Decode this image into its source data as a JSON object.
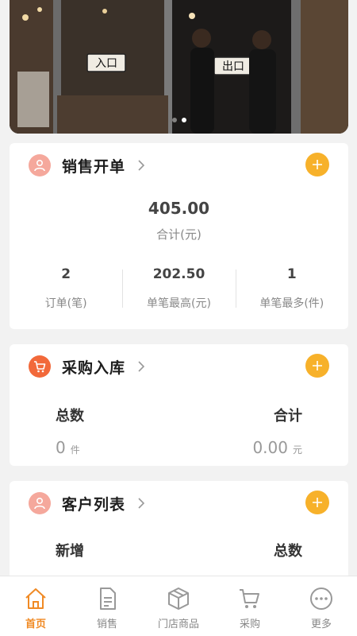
{
  "banner": {
    "sign_left": "入口",
    "sign_right": "出口",
    "slides": 2,
    "active_slide": 1
  },
  "sales": {
    "title": "销售开单",
    "total_value": "405.00",
    "total_label": "合计(元)",
    "stats": [
      {
        "value": "2",
        "label": "订单(笔)"
      },
      {
        "value": "202.50",
        "label": "单笔最高(元)"
      },
      {
        "value": "1",
        "label": "单笔最多(件)"
      }
    ]
  },
  "purchase": {
    "title": "采购入库",
    "left_head": "总数",
    "left_value": "0",
    "left_unit": "件",
    "right_head": "合计",
    "right_value": "0.00",
    "right_unit": "元"
  },
  "customers": {
    "title": "客户列表",
    "left_head": "新增",
    "right_head": "总数"
  },
  "tabbar": {
    "items": [
      {
        "label": "首页",
        "icon": "home-icon",
        "active": true
      },
      {
        "label": "销售",
        "icon": "document-icon",
        "active": false
      },
      {
        "label": "门店商品",
        "icon": "box-icon",
        "active": false
      },
      {
        "label": "采购",
        "icon": "cart-icon",
        "active": false
      },
      {
        "label": "更多",
        "icon": "more-icon",
        "active": false
      }
    ]
  },
  "colors": {
    "accent": "#f7b12a",
    "active_tab": "#f08a24",
    "avatar_pink": "#f5a89c",
    "avatar_orange": "#f2693a"
  }
}
